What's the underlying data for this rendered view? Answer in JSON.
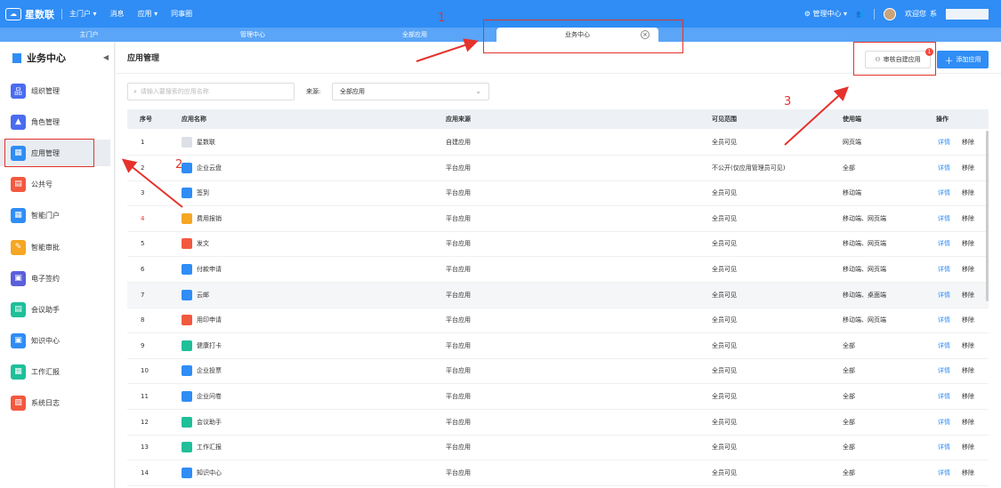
{
  "topbar": {
    "logo": "星数联",
    "nav": [
      "主门户 ▾",
      "消息",
      "应用 ▾",
      "同事圈"
    ],
    "admin": "管理中心 ▾",
    "welcome": "欢迎您",
    "welcome_suffix": "系"
  },
  "tabs": [
    "主门户",
    "管理中心",
    "全部应用",
    "业务中心"
  ],
  "sidebar": {
    "title": "业务中心",
    "items": [
      {
        "label": "组织管理",
        "color": "#4a6cf0"
      },
      {
        "label": "角色管理",
        "color": "#4a6cf0"
      },
      {
        "label": "应用管理",
        "color": "#2f8df5"
      },
      {
        "label": "公共号",
        "color": "#f2593f"
      },
      {
        "label": "智能门户",
        "color": "#2f8df5"
      },
      {
        "label": "智能审批",
        "color": "#f5a623"
      },
      {
        "label": "电子签约",
        "color": "#5b5fd9"
      },
      {
        "label": "会议助手",
        "color": "#1fbf9a"
      },
      {
        "label": "知识中心",
        "color": "#2f8df5"
      },
      {
        "label": "工作汇报",
        "color": "#1fbf9a"
      },
      {
        "label": "系统日志",
        "color": "#f2593f"
      }
    ]
  },
  "main": {
    "title": "应用管理",
    "review_button": "审核自建应用",
    "review_badge": "1",
    "add_button": "添加应用",
    "search_placeholder": "请输入要搜索的应用名称",
    "source_label": "来源:",
    "source_value": "全部应用",
    "columns": [
      "序号",
      "应用名称",
      "应用来源",
      "可见范围",
      "使用端",
      "操作"
    ],
    "rows": [
      {
        "no": "1",
        "name": "星数联",
        "source": "自建应用",
        "scope": "全员可见",
        "client": "网页端",
        "color": "#dcdfe6"
      },
      {
        "no": "2",
        "name": "企业云盘",
        "source": "平台应用",
        "scope": "不公开(仅应用管理员可见)",
        "client": "全部",
        "color": "#2f8df5"
      },
      {
        "no": "3",
        "name": "签到",
        "source": "平台应用",
        "scope": "全员可见",
        "client": "移动端",
        "color": "#2f8df5"
      },
      {
        "no": "4",
        "name": "费用报销",
        "source": "平台应用",
        "scope": "全员可见",
        "client": "移动端、网页端",
        "color": "#f5a623"
      },
      {
        "no": "5",
        "name": "发文",
        "source": "平台应用",
        "scope": "全员可见",
        "client": "移动端、网页端",
        "color": "#f2593f"
      },
      {
        "no": "6",
        "name": "付款申请",
        "source": "平台应用",
        "scope": "全员可见",
        "client": "移动端、网页端",
        "color": "#2f8df5"
      },
      {
        "no": "7",
        "name": "云邮",
        "source": "平台应用",
        "scope": "全员可见",
        "client": "移动端、桌面端",
        "color": "#2f8df5"
      },
      {
        "no": "8",
        "name": "用印申请",
        "source": "平台应用",
        "scope": "全员可见",
        "client": "移动端、网页端",
        "color": "#f2593f"
      },
      {
        "no": "9",
        "name": "健康打卡",
        "source": "平台应用",
        "scope": "全员可见",
        "client": "全部",
        "color": "#1fbf9a"
      },
      {
        "no": "10",
        "name": "企业投票",
        "source": "平台应用",
        "scope": "全员可见",
        "client": "全部",
        "color": "#2f8df5"
      },
      {
        "no": "11",
        "name": "企业问卷",
        "source": "平台应用",
        "scope": "全员可见",
        "client": "全部",
        "color": "#2f8df5"
      },
      {
        "no": "12",
        "name": "会议助手",
        "source": "平台应用",
        "scope": "全员可见",
        "client": "全部",
        "color": "#1fbf9a"
      },
      {
        "no": "13",
        "name": "工作汇报",
        "source": "平台应用",
        "scope": "全员可见",
        "client": "全部",
        "color": "#1fbf9a"
      },
      {
        "no": "14",
        "name": "知识中心",
        "source": "平台应用",
        "scope": "全员可见",
        "client": "全部",
        "color": "#2f8df5"
      }
    ],
    "action_detail": "详情",
    "action_remove": "移除"
  },
  "annotations": [
    "1",
    "2",
    "3"
  ]
}
